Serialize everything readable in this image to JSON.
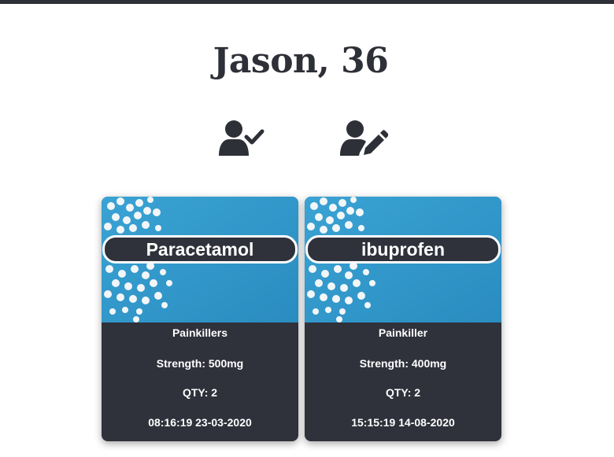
{
  "header": {
    "title": "Jason, 36"
  },
  "actions": {
    "confirm_icon": "user-check-icon",
    "edit_icon": "user-edit-icon"
  },
  "colors": {
    "dark": "#2e3038",
    "card_bg": "#2f313b",
    "image_blue": "#2f96c8"
  },
  "medications": [
    {
      "name": "Paracetamol",
      "category": "Painkillers",
      "strength": "Strength: 500mg",
      "qty": "QTY: 2",
      "timestamp": "08:16:19 23-03-2020"
    },
    {
      "name": "ibuprofen",
      "category": "Painkiller",
      "strength": "Strength: 400mg",
      "qty": "QTY: 2",
      "timestamp": "15:15:19 14-08-2020"
    }
  ]
}
